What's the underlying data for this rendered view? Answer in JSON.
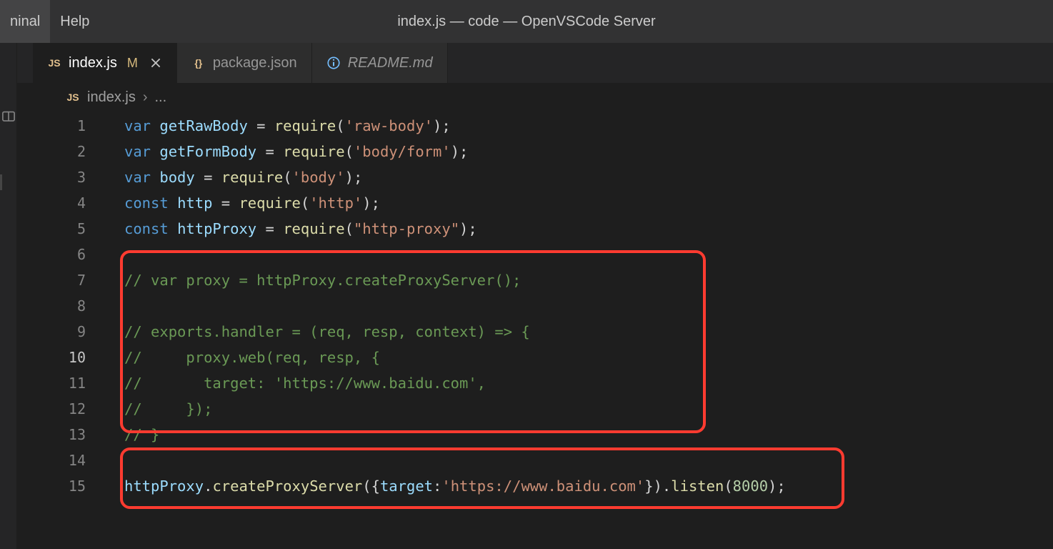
{
  "menu": {
    "items": [
      "ninal",
      "Help"
    ]
  },
  "window_title": "index.js — code — OpenVSCode Server",
  "tabs": [
    {
      "icon_label": "JS",
      "label": "index.js",
      "modified": "M",
      "active": true
    },
    {
      "icon_label": "{}",
      "label": "package.json",
      "active": false
    },
    {
      "icon_label": "ⓘ",
      "label": "README.md",
      "active": false
    }
  ],
  "breadcrumb": {
    "icon_label": "JS",
    "file": "index.js",
    "sep": "›",
    "trail": "..."
  },
  "line_numbers": [
    "1",
    "2",
    "3",
    "4",
    "5",
    "6",
    "7",
    "8",
    "9",
    "10",
    "11",
    "12",
    "13",
    "14",
    "15"
  ],
  "current_line_index": 9,
  "code": {
    "l1": {
      "kw": "var ",
      "v": "getRawBody",
      "eq": " = ",
      "fn": "require",
      "op": "(",
      "s": "'raw-body'",
      "cp": ")",
      "sc": ";"
    },
    "l2": {
      "kw": "var ",
      "v": "getFormBody",
      "eq": " = ",
      "fn": "require",
      "op": "(",
      "s": "'body/form'",
      "cp": ")",
      "sc": ";"
    },
    "l3": {
      "kw": "var ",
      "v": "body",
      "eq": " = ",
      "fn": "require",
      "op": "(",
      "s": "'body'",
      "cp": ")",
      "sc": ";"
    },
    "l4": {
      "kw": "const ",
      "v": "http",
      "eq": " = ",
      "fn": "require",
      "op": "(",
      "s": "'http'",
      "cp": ")",
      "sc": ";"
    },
    "l5": {
      "kw": "const ",
      "v": "httpProxy",
      "eq": " = ",
      "fn": "require",
      "op": "(",
      "s": "\"http-proxy\"",
      "cp": ")",
      "sc": ";"
    },
    "l6": {
      "txt": ""
    },
    "l7": {
      "cmt": "// var proxy = httpProxy.createProxyServer();"
    },
    "l8": {
      "txt": ""
    },
    "l9": {
      "cmt": "// exports.handler = (req, resp, context) => {"
    },
    "l10": {
      "cmt": "//     proxy.web(req, resp, {"
    },
    "l11": {
      "cmt": "//       target: 'https://www.baidu.com',"
    },
    "l12": {
      "cmt": "//     });"
    },
    "l13": {
      "cmt": "// }"
    },
    "l14": {
      "txt": ""
    },
    "l15": {
      "obj": "httpProxy",
      "dot": ".",
      "m1": "createProxyServer",
      "op1": "({",
      "prop": "target",
      "col": ":",
      "s": "'https://www.baidu.com'",
      "cp1": "}).",
      "m2": "listen",
      "op2": "(",
      "num": "8000",
      "cp2": ")",
      "sc": ";"
    }
  }
}
